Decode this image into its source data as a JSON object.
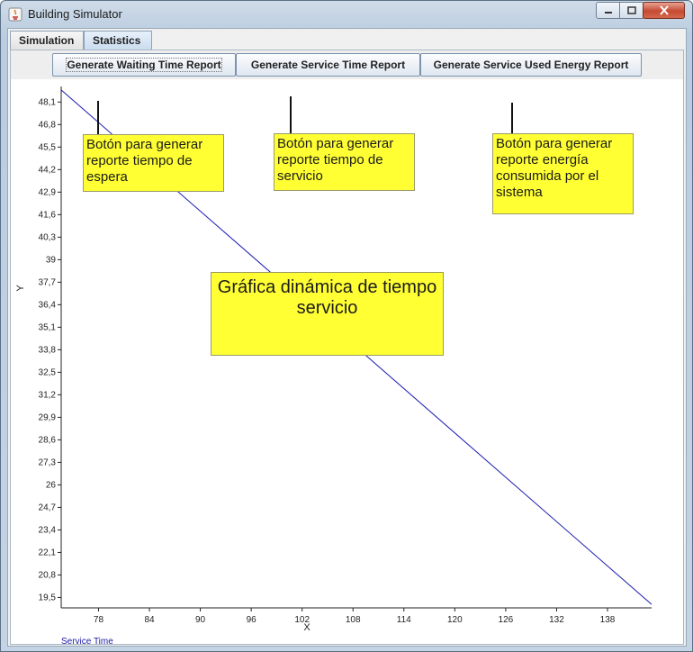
{
  "window": {
    "title": "Building Simulator"
  },
  "tabs": [
    {
      "label": "Simulation",
      "selected": false
    },
    {
      "label": "Statistics",
      "selected": true
    }
  ],
  "toolbar": {
    "waiting_time_label": "Generate Waiting Time Report",
    "service_time_label": "Generate Service Time Report",
    "energy_label": "Generate Service Used Energy Report"
  },
  "annotations": {
    "note_waiting": "Botón para generar reporte tiempo de espera",
    "note_service": "Botón para generar reporte tiempo de servicio",
    "note_energy": "Botón para generar reporte energía consumida por el sistema",
    "note_chart": "Gráfica dinámica de tiempo servicio"
  },
  "colors": {
    "series": "#1a1ab0",
    "note_bg": "#ffff33",
    "arrow_head": "#e8373a"
  },
  "chart_data": {
    "type": "line",
    "xlabel": "X",
    "ylabel": "Y",
    "x_ticks": [
      "78",
      "84",
      "90",
      "96",
      "102",
      "108",
      "114",
      "120",
      "126",
      "132",
      "138"
    ],
    "y_ticks": [
      "19,5",
      "20,8",
      "22,1",
      "23,4",
      "24,7",
      "26",
      "27,3",
      "28,6",
      "29,9",
      "31,2",
      "32,5",
      "33,8",
      "35,1",
      "36,4",
      "37,7",
      "39",
      "40,3",
      "41,6",
      "42,9",
      "44,2",
      "45,5",
      "46,8",
      "48,1"
    ],
    "xlim": [
      73.6,
      143.2
    ],
    "ylim": [
      18.9,
      49.0
    ],
    "series": [
      {
        "name": "Service Time",
        "x": [
          73.6,
          143.2
        ],
        "y": [
          48.8,
          19.1
        ]
      }
    ]
  }
}
